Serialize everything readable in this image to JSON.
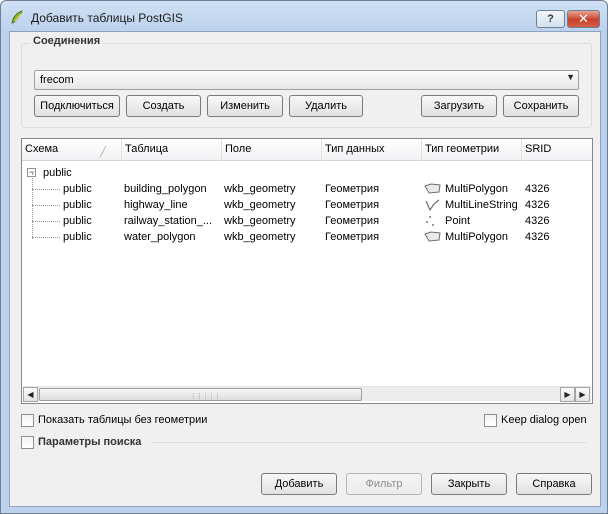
{
  "window": {
    "title": "Добавить таблицы PostGIS",
    "help_label": "?",
    "close_label": "✕"
  },
  "connections": {
    "group_title": "Соединения",
    "selected": "frecom",
    "buttons": {
      "connect": "Подключиться",
      "create": "Создать",
      "edit": "Изменить",
      "delete": "Удалить",
      "load": "Загрузить",
      "save": "Сохранить"
    }
  },
  "table": {
    "columns": [
      "Схема",
      "Таблица",
      "Поле",
      "Тип данных",
      "Тип геометрии",
      "SRID"
    ],
    "parent": "public",
    "rows": [
      {
        "schema": "public",
        "table": "building_polygon",
        "field": "wkb_geometry",
        "data_type": "Геометрия",
        "geometry_type": "MultiPolygon",
        "geom_icon": "polygon-icon",
        "srid": "4326"
      },
      {
        "schema": "public",
        "table": "highway_line",
        "field": "wkb_geometry",
        "data_type": "Геометрия",
        "geometry_type": "MultiLineString",
        "geom_icon": "line-icon",
        "srid": "4326"
      },
      {
        "schema": "public",
        "table": "railway_station_...",
        "field": "wkb_geometry",
        "data_type": "Геометрия",
        "geometry_type": "Point",
        "geom_icon": "point-icon",
        "srid": "4326"
      },
      {
        "schema": "public",
        "table": "water_polygon",
        "field": "wkb_geometry",
        "data_type": "Геометрия",
        "geometry_type": "MultiPolygon",
        "geom_icon": "polygon-icon",
        "srid": "4326"
      }
    ]
  },
  "options": {
    "show_no_geometry": "Показать таблицы без геометрии",
    "keep_dialog_open": "Keep dialog open",
    "search_params": "Параметры поиска"
  },
  "footer": {
    "add": "Добавить",
    "filter": "Фильтр",
    "close": "Закрыть",
    "help": "Справка"
  }
}
